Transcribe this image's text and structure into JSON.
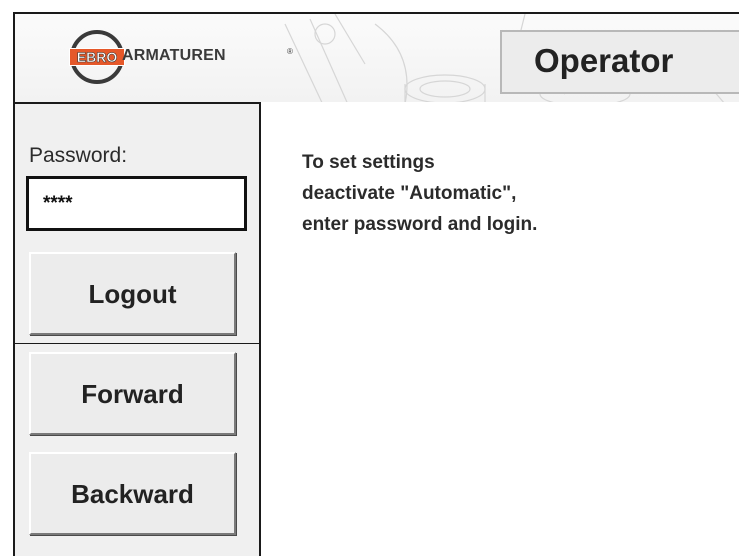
{
  "header": {
    "brand_badge": "EBRO",
    "brand_name": "ARMATUREN",
    "brand_registered": "®",
    "role_label": "Operator"
  },
  "login": {
    "password_label": "Password:",
    "password_value": "****",
    "logout_label": "Logout"
  },
  "navigation": {
    "forward_label": "Forward",
    "backward_label": "Backward"
  },
  "info": {
    "lines": [
      "To set settings",
      "deactivate \"Automatic\",",
      "enter password and login."
    ]
  },
  "colors": {
    "brand_orange": "#e5582a",
    "panel_background": "#f0f0f0",
    "button_face": "#ececec",
    "text": "#222222"
  }
}
